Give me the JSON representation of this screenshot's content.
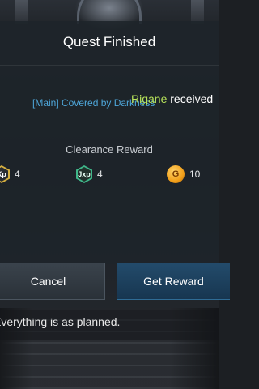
{
  "dialog": {
    "title": "Quest Finished",
    "npc_name": "Rigane",
    "npc_action": "received",
    "quest_name": "[Main] Covered by Darkness",
    "reward_heading": "Clearance Reward",
    "rewards": [
      {
        "icon": "xp-icon",
        "icon_text": "Xp",
        "amount": "4"
      },
      {
        "icon": "jxp-icon",
        "icon_text": "Jxp",
        "amount": "4"
      },
      {
        "icon": "gold-coin-icon",
        "icon_text": "G",
        "amount": "10"
      }
    ]
  },
  "buttons": {
    "cancel_label": "Cancel",
    "get_reward_label": "Get Reward"
  },
  "npc_dialogue": "Everything is as planned.",
  "colors": {
    "npc_name": "#b7e35a",
    "quest_name": "#4ea6d9",
    "get_reward_button": "#1f4a6b"
  }
}
